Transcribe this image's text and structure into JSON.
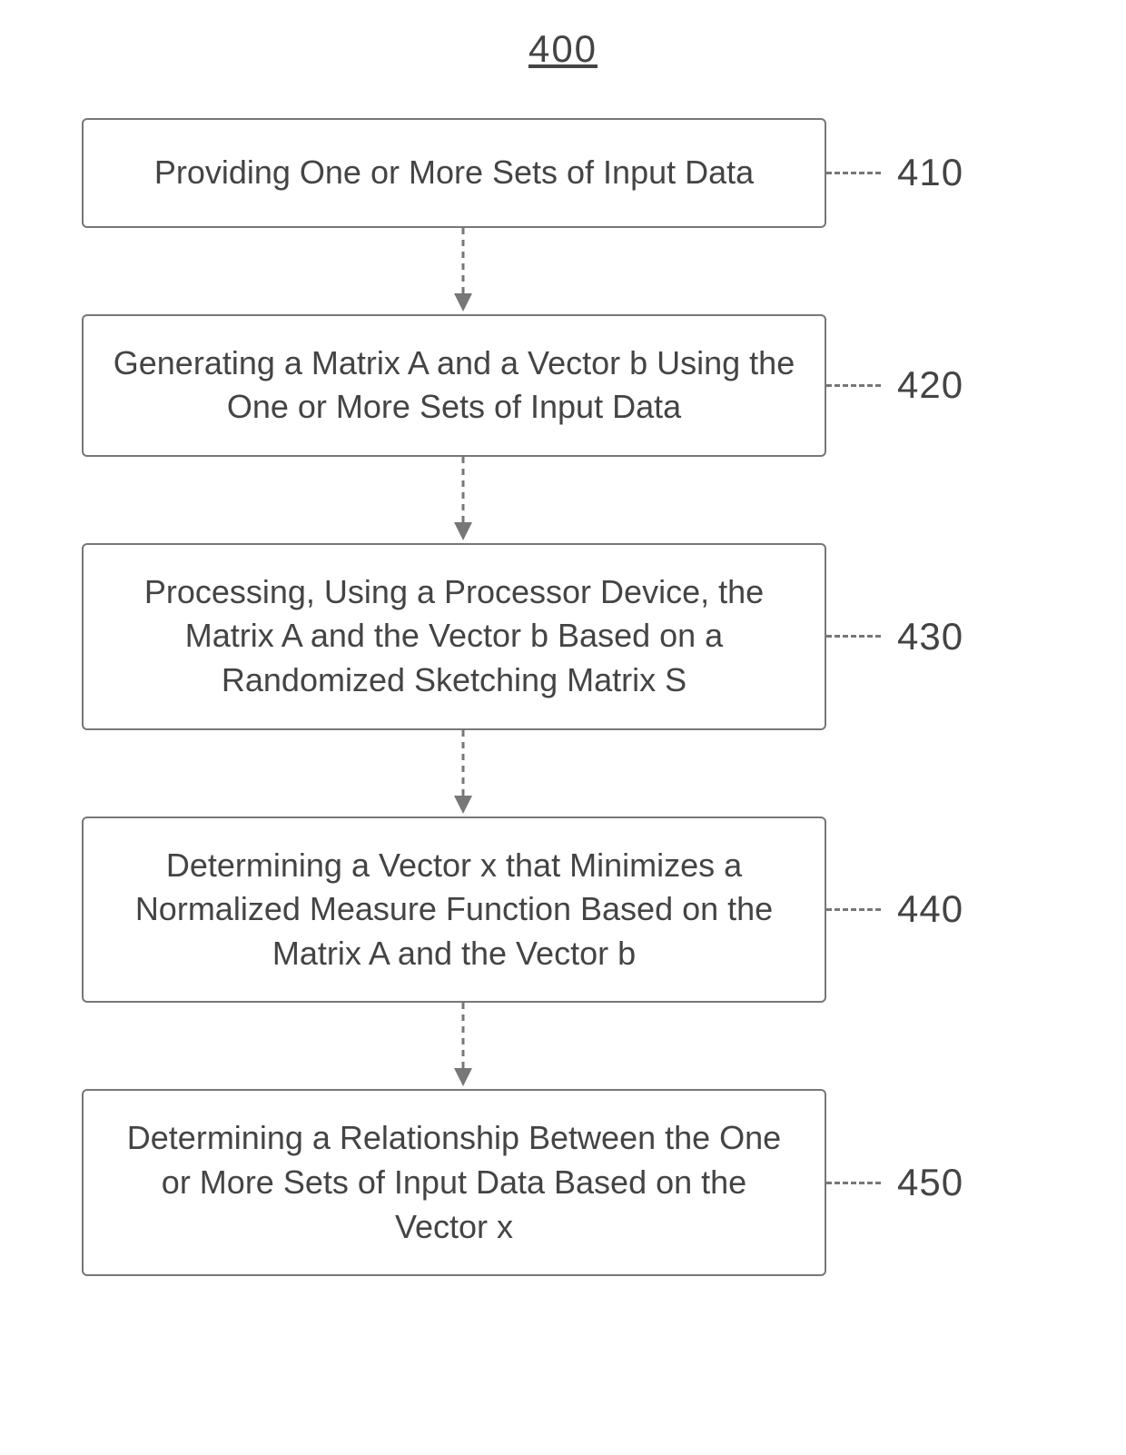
{
  "figure_number": "400",
  "steps": [
    {
      "id": "410",
      "text": "Providing One or More Sets of Input Data"
    },
    {
      "id": "420",
      "text": "Generating a Matrix A and a Vector b Using the One or More Sets of Input Data"
    },
    {
      "id": "430",
      "text": "Processing, Using a Processor Device, the Matrix A and the Vector b Based on a Randomized Sketching Matrix S"
    },
    {
      "id": "440",
      "text": "Determining a Vector x that Minimizes a Normalized Measure Function Based on the Matrix A and the Vector b"
    },
    {
      "id": "450",
      "text": "Determining a Relationship Between the One or More Sets of Input Data Based on the Vector x"
    }
  ]
}
